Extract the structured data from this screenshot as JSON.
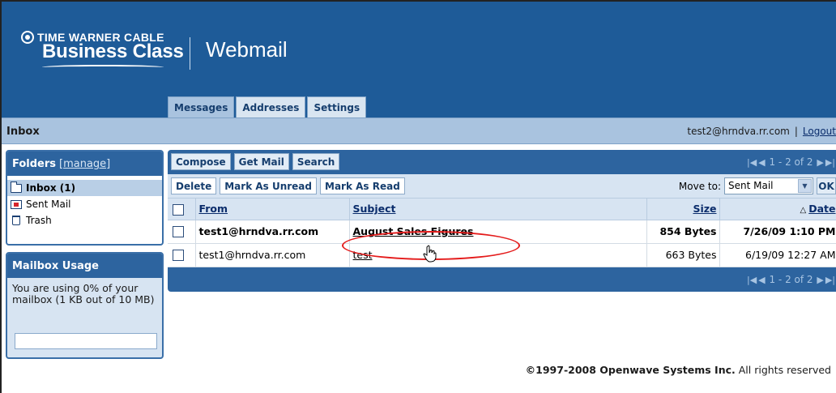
{
  "header": {
    "brand_line1": "TIME WARNER CABLE",
    "brand_line2": "Business Class",
    "product": "Webmail"
  },
  "tabs": [
    {
      "label": "Messages",
      "active": true
    },
    {
      "label": "Addresses",
      "active": false
    },
    {
      "label": "Settings",
      "active": false
    }
  ],
  "topbar": {
    "title": "Inbox",
    "user_email": "test2@hrndva.rr.com",
    "separator": "|",
    "logout": "Logout"
  },
  "folders": {
    "title": "Folders",
    "manage": "[manage]",
    "items": [
      {
        "label": "Inbox (1)",
        "icon": "folder-icon",
        "selected": true
      },
      {
        "label": "Sent Mail",
        "icon": "sent-mail-icon",
        "selected": false
      },
      {
        "label": "Trash",
        "icon": "trash-icon",
        "selected": false
      }
    ]
  },
  "usage": {
    "title": "Mailbox Usage",
    "text": "You are using 0% of your mailbox (1 KB out of 10 MB)",
    "percent": 0
  },
  "toolbar": {
    "compose": "Compose",
    "get_mail": "Get Mail",
    "search": "Search",
    "pager": "1 - 2 of 2",
    "delete": "Delete",
    "mark_unread": "Mark As Unread",
    "mark_read": "Mark As Read",
    "move_to_label": "Move to:",
    "move_to_value": "Sent Mail",
    "ok": "OK"
  },
  "table": {
    "headers": {
      "from": "From",
      "subject": "Subject",
      "size": "Size",
      "date": "Date"
    },
    "rows": [
      {
        "from": "test1@hrndva.rr.com",
        "subject": "August Sales Figures",
        "size": "854 Bytes",
        "date": "7/26/09 1:10 PM",
        "unread": true
      },
      {
        "from": "test1@hrndva.rr.com",
        "subject": "test",
        "size": "663 Bytes",
        "date": "6/19/09 12:27 AM",
        "unread": false
      }
    ]
  },
  "footer": {
    "copyright_bold": "©1997-2008 Openwave Systems Inc.",
    "copyright_rest": " All rights reserved"
  },
  "colors": {
    "header_blue": "#1e5b98",
    "panel_blue": "#2d649f",
    "light_blue": "#d7e4f2",
    "highlight_red": "#e41b1b"
  }
}
